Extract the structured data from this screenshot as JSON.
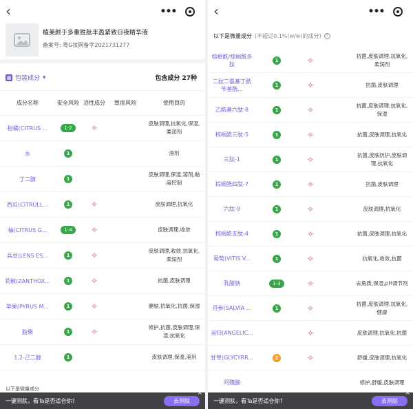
{
  "left": {
    "product_name": "植美颜于多重胜肽丰盈紧致日夜精华液",
    "registration": "备案号: 粤G妆网备字2021731277",
    "pack_label": "包装成分",
    "total_label": "包含成分 27种",
    "headers": [
      "成分名称",
      "安全风险",
      "活性成分",
      "致痘风险",
      "使用目的"
    ],
    "rows": [
      {
        "name": "柑橘(CITRUS ...",
        "safety": "1-2",
        "active": "✧",
        "purpose": "皮肤调理,抗氧化,保湿,柔润剂"
      },
      {
        "name": "水",
        "safety": "1",
        "active": "",
        "purpose": "溶剂"
      },
      {
        "name": "丁二醇",
        "safety": "1",
        "active": "",
        "purpose": "皮肤调理,保湿,溶剂,黏度控制"
      },
      {
        "name": "西瓜(CITRULL...",
        "safety": "1",
        "active": "✧",
        "purpose": "皮肤调理,抗氧化"
      },
      {
        "name": "柚(CITRUS G...",
        "safety": "1-4",
        "active": "✧",
        "purpose": "皮肤调理,收敛"
      },
      {
        "name": "兵豆(LENS ES...",
        "safety": "1",
        "active": "✧",
        "purpose": "皮肤调理,收敛,抗氧化,柔润剂"
      },
      {
        "name": "花椒(ZANTHOX...",
        "safety": "1",
        "active": "✧",
        "purpose": "抗菌,皮肤调理"
      },
      {
        "name": "苹果(PYRUS M...",
        "safety": "1",
        "active": "✧",
        "purpose": "健肤,抗氧化,抗菌,保湿"
      },
      {
        "name": "脂果",
        "safety": "1",
        "active": "✧",
        "purpose": "修护,抗菌,皮肤调理,保湿,抗氧化"
      },
      {
        "name": "1,2-己二醇",
        "safety": "1",
        "active": "",
        "purpose": "皮肤调理,保湿,溶剂"
      }
    ],
    "trace_label": "以下是微量成分",
    "bar_text": "一键测肤，看Ta是否适合你?",
    "bar_button": "去测肤"
  },
  "right": {
    "title": "以下是微量成分",
    "subtitle": "(不超过0.1%(w/w)的成分)",
    "rows": [
      {
        "name": "棕榈酰/棕榈酰多肽",
        "safety": "1",
        "active": "✧",
        "purpose": "抗菌,皮肤调理,抗氧化,柔润剂"
      },
      {
        "name": "二肽二氨基丁酰苄基酰...",
        "safety": "1",
        "active": "✧",
        "purpose": "抗菌,皮肤调理"
      },
      {
        "name": "乙酰基六肽-8",
        "safety": "1",
        "active": "✧",
        "purpose": "抗菌,皮肤调理,抗氧化,保湿"
      },
      {
        "name": "棕榈酰三肽-5",
        "safety": "1",
        "active": "✧",
        "purpose": "抗菌,皮肤调理,抗氧化"
      },
      {
        "name": "三肽-1",
        "safety": "1",
        "active": "✧",
        "purpose": "抗菌,皮肤防护,皮肤调理,抗氧化"
      },
      {
        "name": "棕榈酰四肽-7",
        "safety": "1",
        "active": "✧",
        "purpose": "抗菌,皮肤调理"
      },
      {
        "name": "六肽-9",
        "safety": "1",
        "active": "✧",
        "purpose": "皮肤调理,抗氧化"
      },
      {
        "name": "棕榈酰五肽-4",
        "safety": "1",
        "active": "✧",
        "purpose": "抗菌,皮肤调理,抗氧化"
      },
      {
        "name": "葡萄(VITIS V...",
        "safety": "1",
        "active": "✧",
        "purpose": "抗氧化,收敛,抗菌"
      },
      {
        "name": "乳酸钠",
        "safety": "1-3",
        "active": "✧",
        "purpose": "去角质,保湿,pH调节剂"
      },
      {
        "name": "丹参(SALVIA ...",
        "safety": "1",
        "active": "✧",
        "purpose": "抗菌,皮肤调理,抗氧化,健康"
      },
      {
        "name": "当归(ANGELIC...",
        "safety": "",
        "active": "✧",
        "purpose": "皮肤调理,抗氧化,抗菌"
      },
      {
        "name": "甘草(GLYCYRR...",
        "safety": "2",
        "active": "✧",
        "purpose": "舒缓,皮肤调理,抗氧化"
      },
      {
        "name": "阿魏酸",
        "safety": "",
        "active": "",
        "purpose": "修护,舒缓,皮肤调理"
      }
    ],
    "bar_text": "一键测肤，看Ta是否适合你?",
    "bar_button": "去测肤"
  }
}
